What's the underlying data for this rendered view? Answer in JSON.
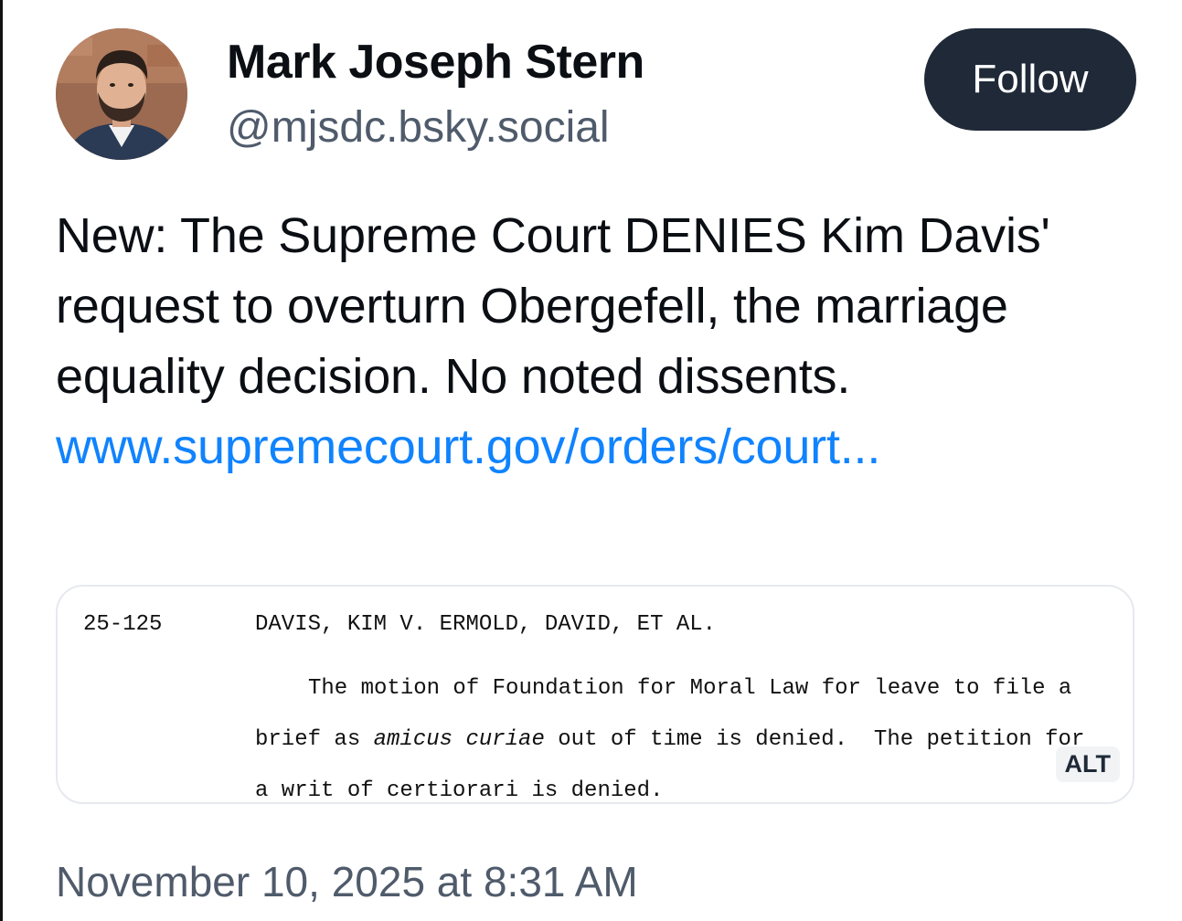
{
  "author": {
    "display_name": "Mark Joseph Stern",
    "handle": "@mjsdc.bsky.social",
    "avatar_icon": "profile-photo"
  },
  "follow_button": {
    "label": "Follow"
  },
  "post": {
    "text": "New: The Supreme Court DENIES Kim Davis' request to overturn Obergefell, the marriage equality decision. No noted dissents.",
    "link_text": "www.supremecourt.gov/orders/court...",
    "link_color": "#1083fe"
  },
  "embed_image": {
    "docket_number": "25-125",
    "case_title": "DAVIS, KIM V. ERMOLD, DAVID, ET AL.",
    "line1": "The motion of Foundation for Moral Law for leave to file a",
    "line2_pre": "brief as ",
    "line2_italic": "amicus curiae",
    "line2_post": " out of time is denied.  The petition for",
    "line3": "a writ of certiorari is denied.",
    "alt_badge": "ALT"
  },
  "timestamp": "November 10, 2025 at 8:31 AM",
  "colors": {
    "follow_bg": "#1f2937",
    "secondary_text": "#4f5b6b",
    "link": "#1083fe"
  }
}
